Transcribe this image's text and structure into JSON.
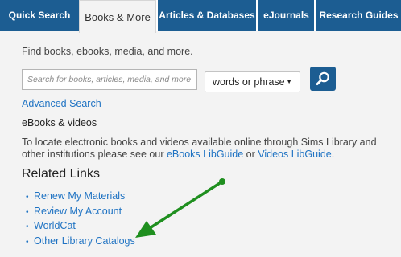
{
  "tabs": [
    {
      "label": "Quick Search",
      "active": false
    },
    {
      "label": "Books & More",
      "active": true
    },
    {
      "label": "Articles & Databases",
      "active": false
    },
    {
      "label": "eJournals",
      "active": false
    },
    {
      "label": "Research Guides",
      "active": false
    }
  ],
  "search": {
    "intro": "Find books, ebooks, media, and more.",
    "placeholder": "Search for books, articles, media, and more",
    "scope_selected": "words or phrase",
    "button_icon": "search-icon"
  },
  "advanced_search_label": "Advanced Search",
  "ebooks": {
    "heading": "eBooks & videos",
    "desc_before": "To locate electronic books and videos available online through Sims Library and other institutions please see our ",
    "ebooks_link": "eBooks LibGuide",
    "desc_middle": " or ",
    "videos_link": "Videos LibGuide",
    "desc_after": "."
  },
  "related": {
    "heading": "Related Links",
    "links": [
      {
        "label": "Renew My Materials"
      },
      {
        "label": "Review My Account"
      },
      {
        "label": "WorldCat"
      },
      {
        "label": "Other Library Catalogs"
      }
    ]
  },
  "colors": {
    "tab_blue": "#1c5d92",
    "link_blue": "#1f73c3",
    "panel_bg": "#f3f3f3",
    "annotation_green": "#1f8f1f"
  }
}
